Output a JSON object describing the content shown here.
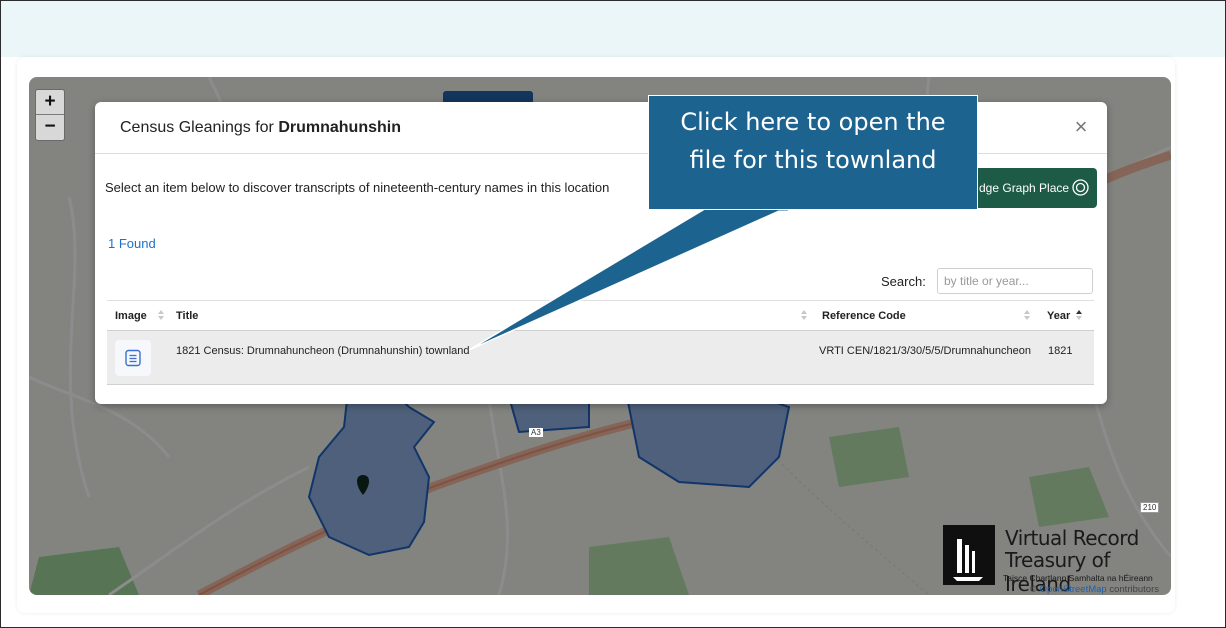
{
  "map": {
    "zoom_in": "+",
    "zoom_out": "−",
    "road_a3": "A3",
    "road_right": "210",
    "osm_prefix": "© ",
    "osm_link": "OpenStreetMap",
    "osm_suffix": " contributors"
  },
  "modal": {
    "title_prefix": "Census Gleanings for ",
    "title_place": "Drumnahunshin",
    "close_label": "×",
    "subtitle": "Select an item below to discover transcripts of nineteenth-century names in this location",
    "kg_button_label": "dge Graph Place",
    "found_label": "1 Found",
    "search_label": "Search:",
    "search_placeholder": "by title or year...",
    "columns": {
      "image": "Image",
      "title": "Title",
      "reference": "Reference Code",
      "year": "Year"
    },
    "rows": [
      {
        "title": "1821 Census: Drumnahuncheon (Drumnahunshin) townland",
        "reference": "VRTI CEN/1821/3/30/5/5/Drumnahuncheon",
        "year": "1821"
      }
    ]
  },
  "callout": {
    "line1": "Click here to open the",
    "line2": "file for this townland"
  },
  "logo": {
    "line1": "Virtual Record",
    "line2": "Treasury of Ireland",
    "line3": "Taisce Chartlann Samhalta na hÉireann"
  },
  "colors": {
    "callout": "#1d6390",
    "kg_button": "#1e5b46",
    "link": "#1a73c8",
    "townland_fill": "#5b85c8"
  }
}
